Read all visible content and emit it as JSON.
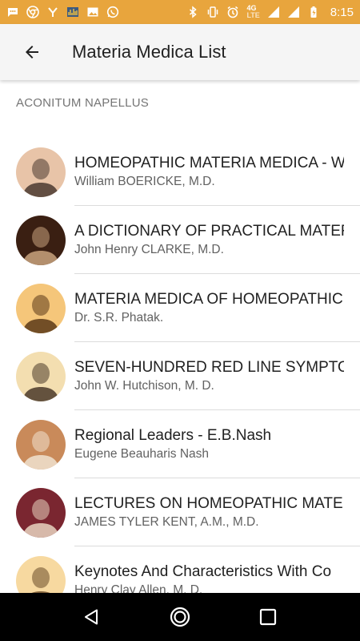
{
  "status_bar": {
    "time": "8:15",
    "network": "4G",
    "network_sub": "LTE",
    "left_icons": [
      "message-icon",
      "chrome-icon",
      "yahoo-icon",
      "audio-app-icon",
      "image-icon",
      "whatsapp-icon"
    ],
    "right_icons": [
      "bluetooth-icon",
      "vibrate-icon",
      "alarm-icon",
      "signal-icon",
      "signal-icon",
      "battery-icon"
    ]
  },
  "app_bar": {
    "title": "Materia Medica List",
    "back_icon": "arrow-back-icon"
  },
  "section": {
    "header": "ACONITUM NAPELLUS"
  },
  "books": [
    {
      "title": "HOMEOPATHIC MATERIA MEDICA - W",
      "author": "William BOERICKE, M.D.",
      "avatar_bg": "#e8c4a8",
      "avatar_fg": "#4a3a30"
    },
    {
      "title": "A DICTIONARY OF PRACTICAL MATER",
      "author": "John Henry CLARKE, M.D.",
      "avatar_bg": "#3a1f12",
      "avatar_fg": "#c9a37e"
    },
    {
      "title": "MATERIA MEDICA OF HOMEOPATHIC",
      "author": "Dr. S.R. Phatak.",
      "avatar_bg": "#f5c67a",
      "avatar_fg": "#5a3818"
    },
    {
      "title": "SEVEN-HUNDRED RED LINE SYMPTON",
      "author": "John W. Hutchison, M. D.",
      "avatar_bg": "#f3deb0",
      "avatar_fg": "#4a3a2a"
    },
    {
      "title": "Regional Leaders - E.B.Nash",
      "author": "Eugene Beauharis Nash",
      "avatar_bg": "#c98a5a",
      "avatar_fg": "#f0e2d0"
    },
    {
      "title": "LECTURES ON HOMEOPATHIC MATER",
      "author": "JAMES TYLER KENT, A.M., M.D.",
      "avatar_bg": "#7a2630",
      "avatar_fg": "#e8d4c0"
    },
    {
      "title": "Keynotes And Characteristics With Co",
      "author": "Henry Clay Allen, M. D.",
      "avatar_bg": "#f7d9a0",
      "avatar_fg": "#6a4a28"
    }
  ],
  "nav_bar": {
    "buttons": [
      "back-triangle-icon",
      "home-circle-icon",
      "recents-square-icon"
    ]
  },
  "colors": {
    "status_bar": "#e8a53d",
    "app_bar": "#f5f5f5",
    "nav_bar": "#000000"
  }
}
